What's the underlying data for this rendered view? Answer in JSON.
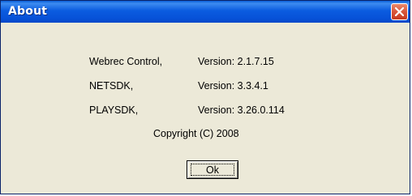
{
  "window": {
    "title": "About",
    "close_icon": "close-icon",
    "title_bar_color": "#0b5ce0",
    "close_button_color": "#d9553a",
    "background_color": "#ece9d8"
  },
  "components": [
    {
      "name": "Webrec Control,",
      "version": "Version: 2.1.7.15"
    },
    {
      "name": "NETSDK,",
      "version": "Version: 3.3.4.1"
    },
    {
      "name": "PLAYSDK,",
      "version": "Version: 3.26.0.114"
    }
  ],
  "copyright": "Copyright (C) 2008",
  "ok_label": "Ok"
}
